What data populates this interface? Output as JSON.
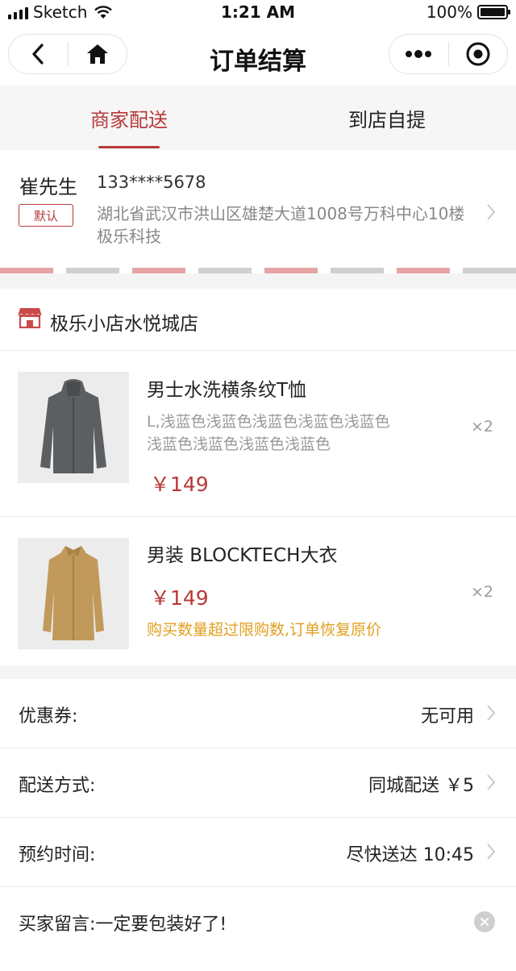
{
  "status_bar": {
    "carrier": "Sketch",
    "time": "1:21 AM",
    "battery": "100%"
  },
  "nav": {
    "title": "订单结算",
    "icons": [
      "back-icon",
      "home-icon",
      "more-icon",
      "close-target-icon"
    ]
  },
  "tabs": [
    {
      "label": "商家配送",
      "active": true
    },
    {
      "label": "到店自提",
      "active": false
    }
  ],
  "address": {
    "name": "崔先生",
    "badge": "默认",
    "phone": "133****5678",
    "detail": "湖北省武汉市洪山区雄楚大道1008号万科中心10楼极乐科技"
  },
  "shop": {
    "name": "极乐小店水悦城店",
    "icon": "shop-icon"
  },
  "items": [
    {
      "name": "男士水洗横条纹T恤",
      "spec": "L,浅蓝色浅蓝色浅蓝色浅蓝色浅蓝色浅蓝色浅蓝色浅蓝色浅蓝色",
      "price": "￥149",
      "qty": "×2",
      "image": "gray-hooded-coat"
    },
    {
      "name": "男装 BLOCKTECH大衣",
      "price": "￥149",
      "qty": "×2",
      "warning": "购买数量超过限购数,订单恢复原价",
      "image": "beige-trench-coat"
    }
  ],
  "options": {
    "coupon": {
      "label": "优惠券:",
      "value": "无可用"
    },
    "delivery": {
      "label": "配送方式:",
      "value": "同城配送 ￥5"
    },
    "schedule": {
      "label": "预约时间:",
      "value": "尽快送达 10:45"
    },
    "message": {
      "label": "买家留言:",
      "value": "一定要包装好了!"
    }
  },
  "colors": {
    "accent": "#b8393a",
    "warning": "#e0a020",
    "muted": "#999999"
  }
}
